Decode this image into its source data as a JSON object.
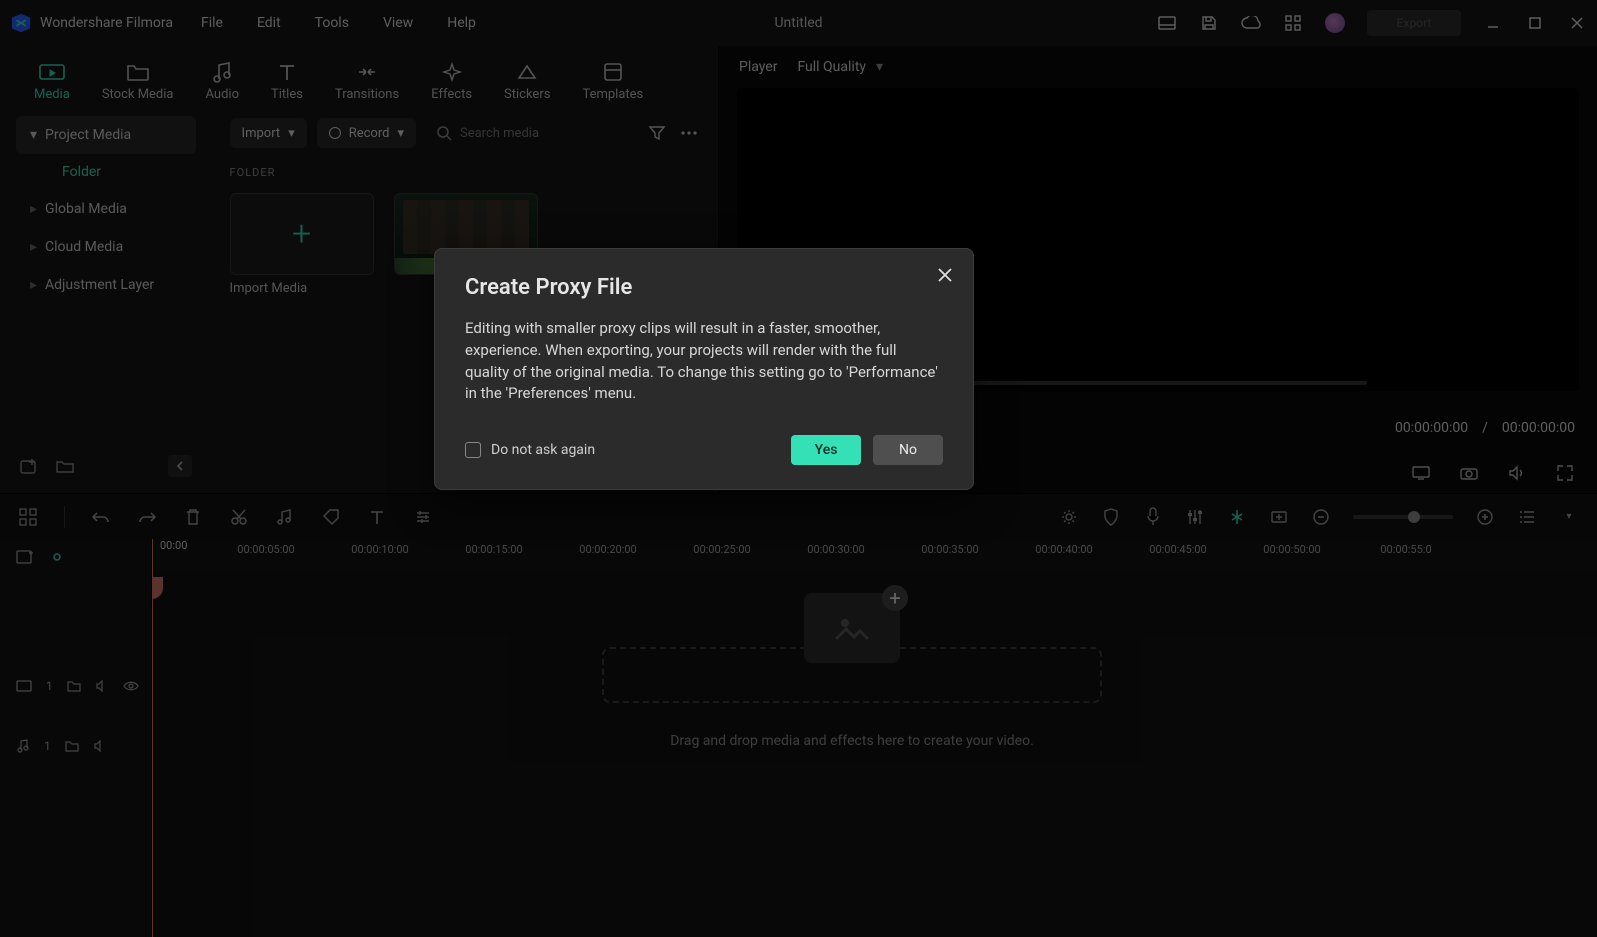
{
  "app": {
    "name": "Wondershare Filmora",
    "document": "Untitled",
    "export_label": "Export"
  },
  "menubar": [
    "File",
    "Edit",
    "Tools",
    "View",
    "Help"
  ],
  "modules": [
    {
      "label": "Media",
      "active": true
    },
    {
      "label": "Stock Media"
    },
    {
      "label": "Audio"
    },
    {
      "label": "Titles"
    },
    {
      "label": "Transitions"
    },
    {
      "label": "Effects"
    },
    {
      "label": "Stickers"
    },
    {
      "label": "Templates"
    }
  ],
  "sidebar": {
    "items": [
      {
        "label": "Project Media",
        "active": true
      },
      {
        "label": "Global Media"
      },
      {
        "label": "Cloud Media"
      },
      {
        "label": "Adjustment Layer"
      }
    ],
    "child": "Folder"
  },
  "mediatoolbar": {
    "import_label": "Import",
    "record_label": "Record",
    "search_placeholder": "Search media"
  },
  "media": {
    "section_label": "FOLDER",
    "import_caption": "Import Media"
  },
  "player": {
    "tab": "Player",
    "quality": "Full Quality",
    "time_current": "00:00:00:00",
    "time_sep": "/",
    "time_total": "00:00:00:00"
  },
  "timeline": {
    "position": "00:00",
    "keys": [
      "00:00:05:00",
      "00:00:10:00",
      "00:00:15:00",
      "00:00:20:00",
      "00:00:25:00",
      "00:00:30:00",
      "00:00:35:00",
      "00:00:40:00",
      "00:00:45:00",
      "00:00:50:00",
      "00:00:55:0"
    ],
    "drop_hint": "Drag and drop media and effects here to create your video.",
    "track_video_index": "1",
    "track_audio_index": "1"
  },
  "modal": {
    "title": "Create Proxy File",
    "body": "Editing with smaller proxy clips will result in a faster, smoother, experience. When exporting, your projects will render with the full quality of the original media. To change this setting go to 'Performance' in the 'Preferences' menu.",
    "checkbox_label": "Do not ask again",
    "yes": "Yes",
    "no": "No"
  }
}
